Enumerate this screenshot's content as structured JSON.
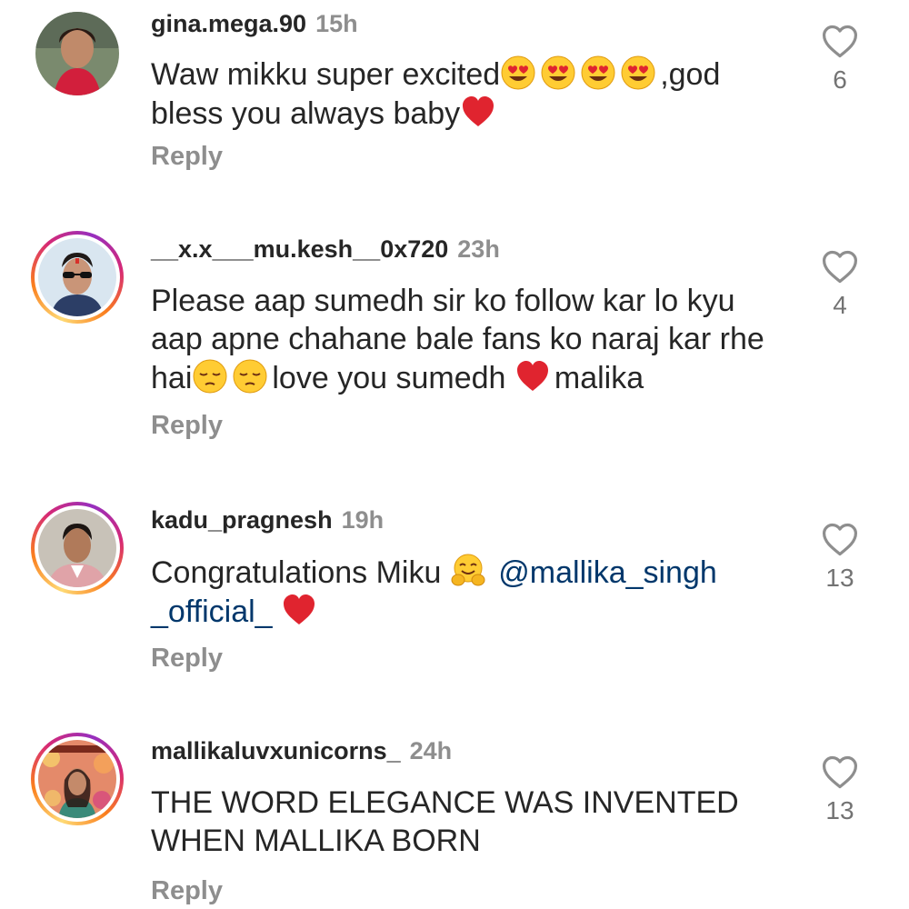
{
  "comments": [
    {
      "username": "gina.mega.90",
      "time": "15h",
      "text_parts": [
        "Waw mikku super excited",
        ",god bless you always baby"
      ],
      "reply_label": "Reply",
      "likes": "6"
    },
    {
      "username": "__x.x___mu.kesh__0x720",
      "time": "23h",
      "text_parts": [
        "Please aap sumedh sir ko follow kar lo kyu aap apne chahane bale fans ko naraj kar rhe hai",
        "love you  sumedh ",
        "malika"
      ],
      "reply_label": "Reply",
      "likes": "4"
    },
    {
      "username": "kadu_pragnesh",
      "time": "19h",
      "text_parts": [
        "Congratulations Miku "
      ],
      "mention": "@mallika_singh _official_",
      "reply_label": "Reply",
      "likes": "13"
    },
    {
      "username": "mallikaluvxunicorns_",
      "time": "24h",
      "text_parts": [
        "THE WORD ELEGANCE WAS INVENTED WHEN MALLIKA BORN"
      ],
      "reply_label": "Reply",
      "likes": "13"
    }
  ],
  "icons": {
    "like": "heart-outline-icon",
    "heart_eyes": "heart-eyes-emoji",
    "pensive": "pensive-face-emoji",
    "red_heart": "red-heart-emoji",
    "hugging": "hugging-face-emoji"
  },
  "colors": {
    "text": "#262626",
    "meta": "#8e8e8e",
    "mention": "#00376b",
    "heart": "#e0242f"
  }
}
